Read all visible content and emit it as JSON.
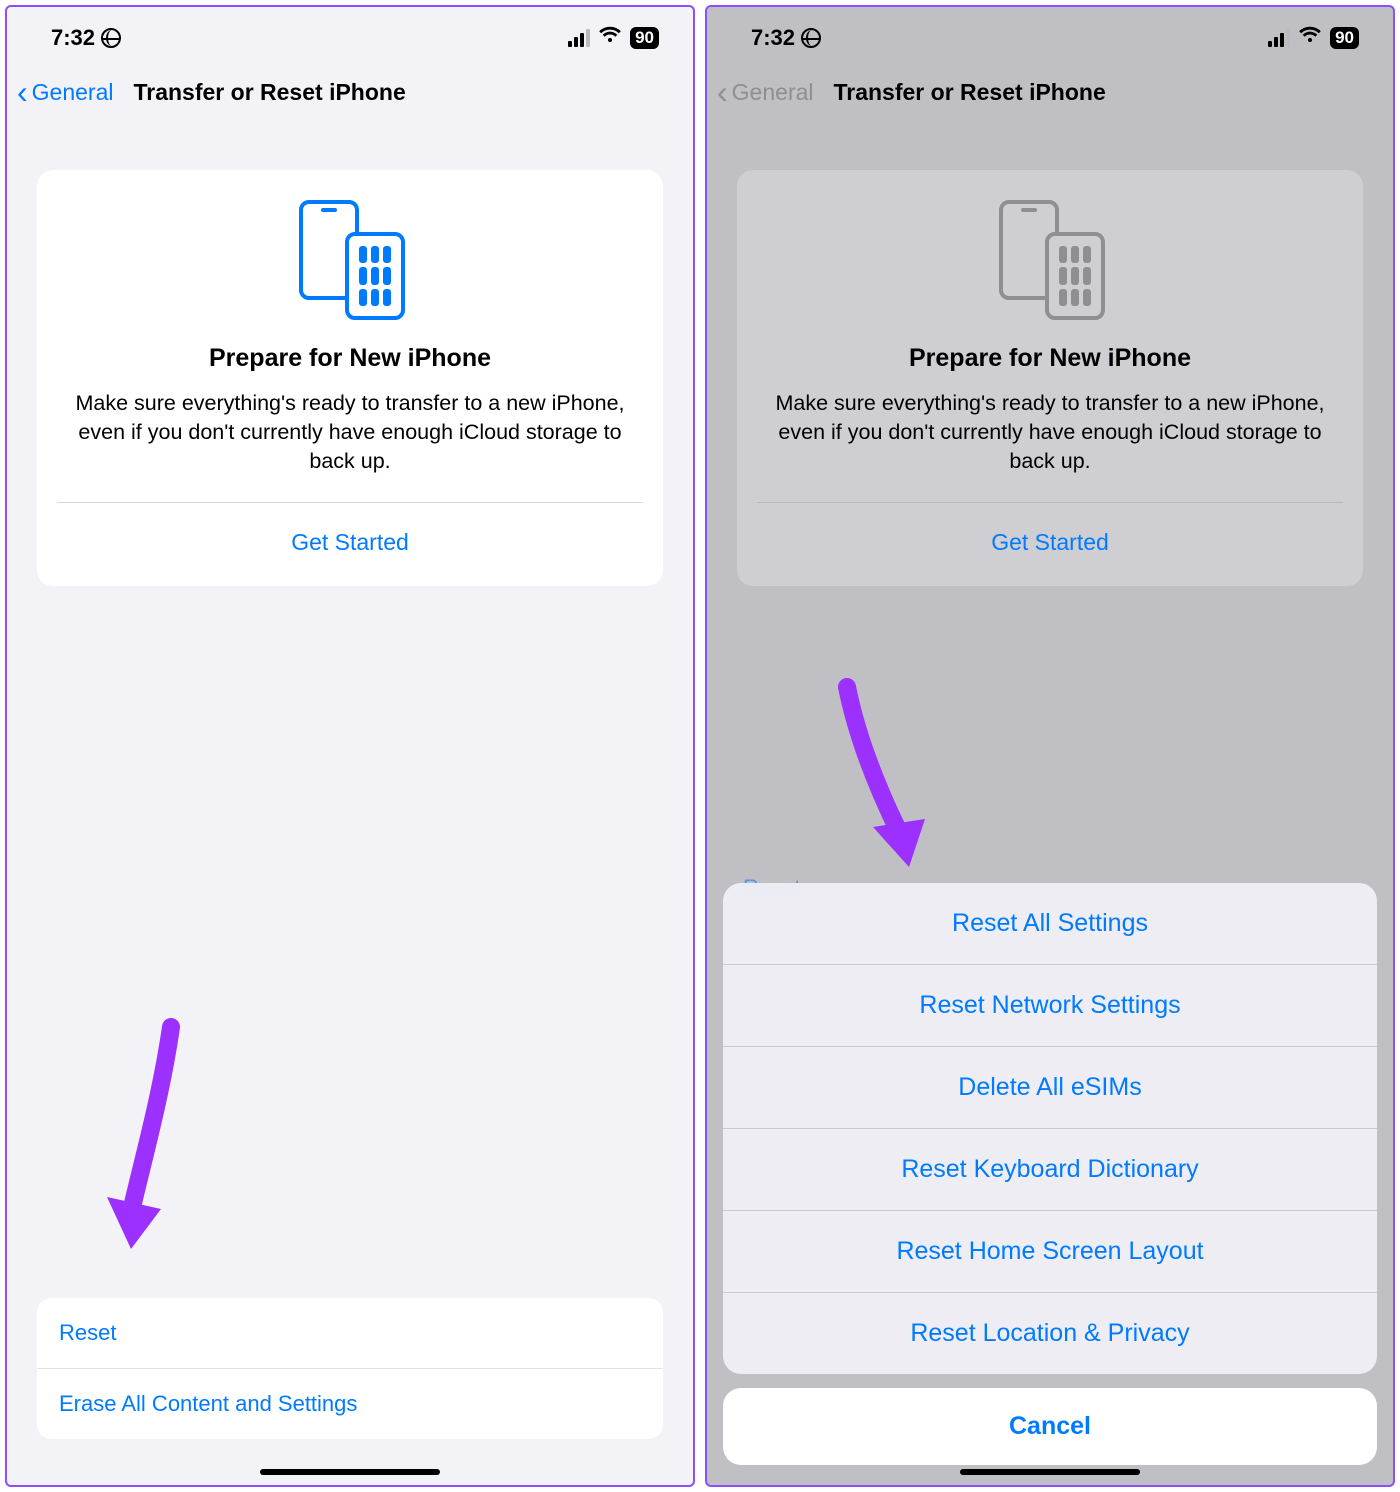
{
  "status": {
    "time": "7:32",
    "battery": "90"
  },
  "nav": {
    "back": "General",
    "title": "Transfer or Reset iPhone"
  },
  "card": {
    "heading": "Prepare for New iPhone",
    "body": "Make sure everything's ready to transfer to a new iPhone, even if you don't currently have enough iCloud storage to back up.",
    "cta": "Get Started"
  },
  "left": {
    "rows": [
      "Reset",
      "Erase All Content and Settings"
    ]
  },
  "right": {
    "peek": "Reset",
    "options": [
      "Reset All Settings",
      "Reset Network Settings",
      "Delete All eSIMs",
      "Reset Keyboard Dictionary",
      "Reset Home Screen Layout",
      "Reset Location & Privacy"
    ],
    "cancel": "Cancel"
  }
}
